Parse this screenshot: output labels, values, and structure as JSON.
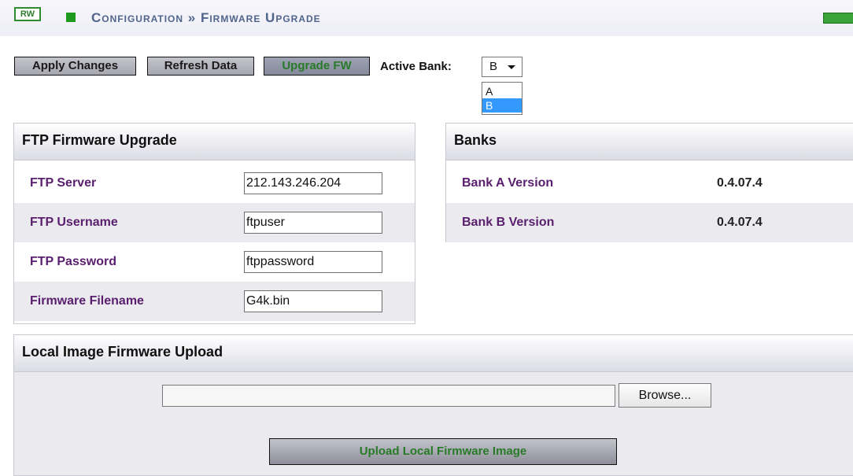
{
  "header": {
    "rw_badge": "RW",
    "breadcrumb": "Configuration » Firmware Upgrade"
  },
  "toolbar": {
    "apply_label": "Apply Changes",
    "refresh_label": "Refresh Data",
    "upgrade_label": "Upgrade FW",
    "active_bank_label": "Active Bank:",
    "active_bank_value": "B",
    "bank_options": [
      "A",
      "B"
    ]
  },
  "ftp": {
    "title": "FTP Firmware Upgrade",
    "rows": [
      {
        "label": "FTP Server",
        "value": "212.143.246.204"
      },
      {
        "label": "FTP Username",
        "value": "ftpuser"
      },
      {
        "label": "FTP Password",
        "value": "ftppassword"
      },
      {
        "label": "Firmware Filename",
        "value": "G4k.bin"
      }
    ]
  },
  "banks": {
    "title": "Banks",
    "rows": [
      {
        "label": "Bank A Version",
        "value": "0.4.07.4"
      },
      {
        "label": "Bank B Version",
        "value": "0.4.07.4"
      }
    ]
  },
  "local": {
    "title": "Local Image Firmware Upload",
    "browse_label": "Browse...",
    "upload_label": "Upload Local Firmware Image"
  },
  "colors": {
    "accent_green": "#1e9a1e",
    "label_purple": "#5a1e6e",
    "breadcrumb_blue": "#50648c",
    "selected_option": "#3399ff"
  }
}
